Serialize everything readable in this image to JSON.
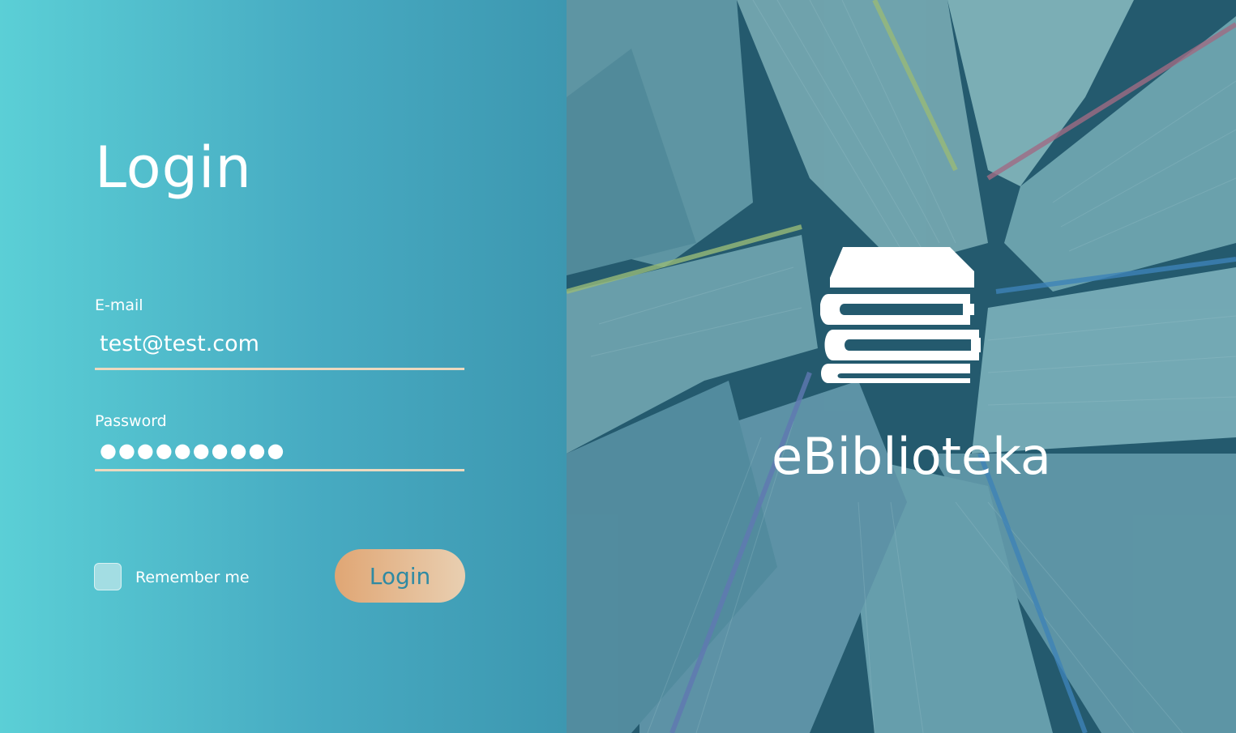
{
  "login": {
    "title": "Login",
    "email": {
      "label": "E-mail",
      "value": "test@test.com"
    },
    "password": {
      "label": "Password",
      "value": "●●●●●●●●●●"
    },
    "remember": {
      "label": "Remember me",
      "checked": false
    },
    "submit_label": "Login"
  },
  "brand": {
    "name": "eBiblioteka",
    "icon": "books-stack-icon"
  },
  "colors": {
    "panel_gradient_start": "#5bcfd6",
    "panel_gradient_end": "#3d97b0",
    "input_underline": "#ecd9bf",
    "button_gradient_start": "#e0a674",
    "button_gradient_end": "#e9cfb1",
    "button_text": "#2f8aa3"
  }
}
